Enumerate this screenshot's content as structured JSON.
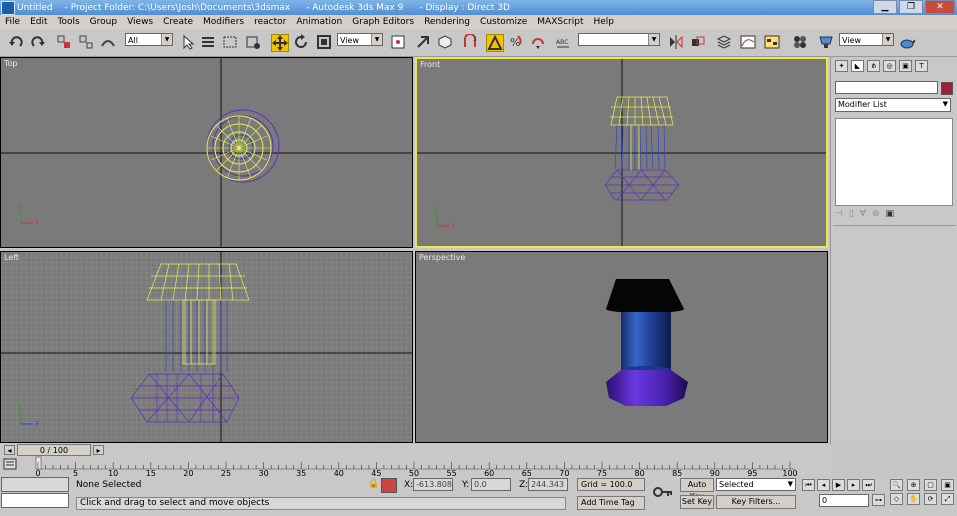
{
  "title_bar": {
    "doc": "Untitled",
    "project": "- Project Folder: C:\\Users\\Josh\\Documents\\3dsmax",
    "app": "- Autodesk 3ds Max 9",
    "display": "- Display : Direct 3D"
  },
  "menu": [
    "File",
    "Edit",
    "Tools",
    "Group",
    "Views",
    "Create",
    "Modifiers",
    "reactor",
    "Animation",
    "Graph Editors",
    "Rendering",
    "Customize",
    "MAXScript",
    "Help"
  ],
  "toolbar": {
    "selection_filter": "All",
    "ref_coord": "View",
    "render_view": "View"
  },
  "viewports": {
    "top": "Top",
    "front": "Front",
    "left": "Left",
    "perspective": "Perspective"
  },
  "axis": {
    "x": "x",
    "y": "y",
    "z": "z"
  },
  "command_panel": {
    "modifier_list": "Modifier List"
  },
  "time_slider": {
    "frame": "0 / 100"
  },
  "track_ticks": [
    "0",
    "5",
    "10",
    "15",
    "20",
    "25",
    "30",
    "35",
    "40",
    "45",
    "50",
    "55",
    "60",
    "65",
    "70",
    "75",
    "80",
    "85",
    "90",
    "95",
    "100"
  ],
  "status": {
    "selection": "None Selected",
    "prompt": "Click and drag to select and move objects",
    "x_label": "X:",
    "x_value": "-613.808",
    "y_label": "Y:",
    "y_value": "0.0",
    "z_label": "Z:",
    "z_value": "244.343",
    "grid": "Grid = 100.0",
    "add_time_tag": "Add Time Tag",
    "auto_key": "Auto Key",
    "set_key": "Set Key",
    "selected": "Selected",
    "key_filters": "Key Filters...",
    "frame_spinner": "0"
  },
  "colors": {
    "selected_wire": "#e8f050",
    "blue_wire": "#3040d0",
    "purple_wire": "#5a30c0",
    "active_border": "#e8e84a"
  }
}
